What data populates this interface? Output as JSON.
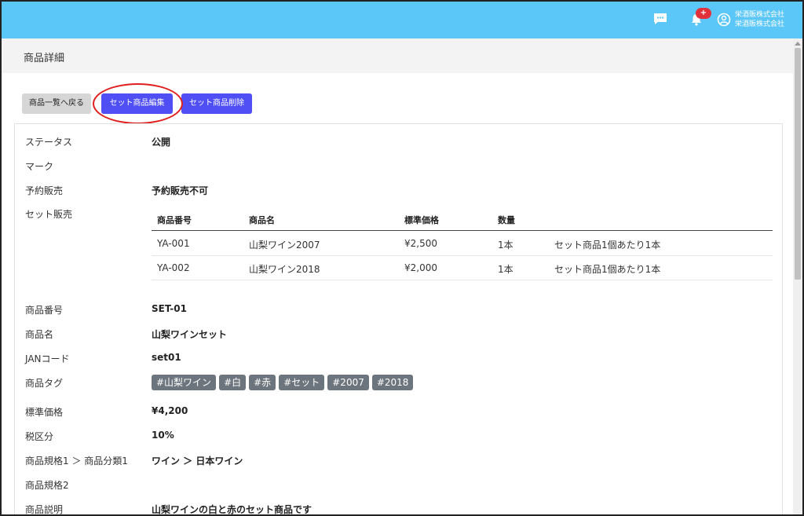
{
  "header": {
    "notification_count": "+",
    "company_line1": "栄酒販株式会社",
    "company_line2": "栄酒販株式会社"
  },
  "page": {
    "title": "商品詳細"
  },
  "toolbar": {
    "back_label": "商品一覧へ戻る",
    "edit_label": "セット商品編集",
    "delete_label": "セット商品削除"
  },
  "details": {
    "status_label": "ステータス",
    "status_value": "公開",
    "mark_label": "マーク",
    "preorder_label": "予約販売",
    "preorder_value": "予約販売不可",
    "set_label": "セット販売",
    "code_label": "商品番号",
    "code_value": "SET-01",
    "name_label": "商品名",
    "name_value": "山梨ワインセット",
    "jan_label": "JANコード",
    "jan_value": "set01",
    "tags_label": "商品タグ",
    "price_label": "標準価格",
    "price_value": "¥4,200",
    "tax_label": "税区分",
    "tax_value": "10%",
    "spec1_label": "商品規格1 ＞ 商品分類1",
    "spec1_value": "ワイン ＞ 日本ワイン",
    "spec2_label": "商品規格2",
    "desc_label": "商品説明",
    "desc_value": "山梨ワインの白と赤のセット商品です"
  },
  "set_table": {
    "headers": [
      "商品番号",
      "商品名",
      "標準価格",
      "数量"
    ],
    "rows": [
      {
        "code": "YA-001",
        "name": "山梨ワイン2007",
        "price": "¥2,500",
        "qty": "1本",
        "note": "セット商品1個あたり1本"
      },
      {
        "code": "YA-002",
        "name": "山梨ワイン2018",
        "price": "¥2,000",
        "qty": "1本",
        "note": "セット商品1個あたり1本"
      }
    ]
  },
  "tags": [
    "#山梨ワイン",
    "#白",
    "#赤",
    "#セット",
    "#2007",
    "#2018"
  ],
  "colors": {
    "topbar": "#5bc7f9",
    "primary_button": "#4f4ff5",
    "tag": "#6c757d",
    "badge": "#e0313b",
    "highlight": "#e01f1f"
  },
  "icons": {
    "chat": "chat-icon",
    "bell": "bell-icon",
    "user": "user-circle-icon"
  }
}
